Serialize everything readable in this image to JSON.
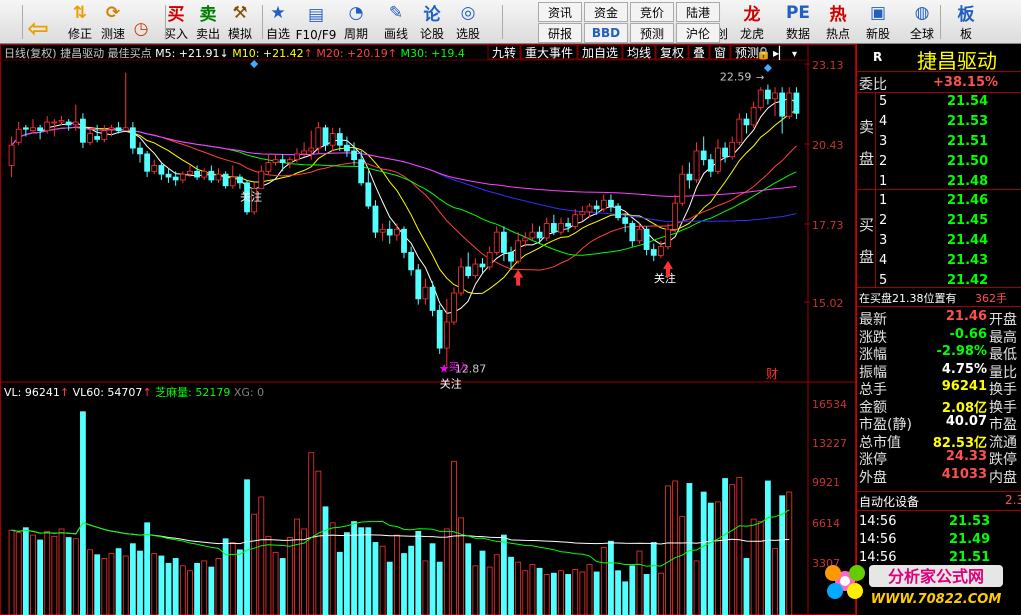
{
  "toolbar": {
    "items": [
      {
        "label": "",
        "icon": "back-arrow-icon"
      },
      {
        "label": "修正",
        "icon": "up-down-arrows-icon"
      },
      {
        "label": "测速",
        "icon": "refresh-icon"
      },
      {
        "label": "",
        "icon": "clock-icon"
      },
      {
        "label": "买入",
        "icon": "buy-icon"
      },
      {
        "label": "卖出",
        "icon": "sell-icon"
      },
      {
        "label": "模拟",
        "icon": "hammer-icon"
      },
      {
        "label": "自选",
        "icon": "star-icon"
      },
      {
        "label": "F10/F9",
        "icon": "f10-icon"
      },
      {
        "label": "周期",
        "icon": "period-icon"
      },
      {
        "label": "画线",
        "icon": "pen-icon"
      },
      {
        "label": "论股",
        "icon": "discuss-icon"
      },
      {
        "label": "选股",
        "icon": "select-stock-icon"
      },
      {
        "label": "科创",
        "icon": "sci-tech-icon"
      },
      {
        "label": "龙虎",
        "icon": "dragon-tiger-icon"
      },
      {
        "label": "数据",
        "icon": "pe-data-icon"
      },
      {
        "label": "热点",
        "icon": "hot-icon"
      },
      {
        "label": "新股",
        "icon": "new-stock-icon"
      },
      {
        "label": "全球",
        "icon": "globe-icon"
      },
      {
        "label": "板",
        "icon": "board-icon"
      }
    ],
    "grid": [
      [
        "资讯",
        "资金",
        "竞价",
        "陆港"
      ],
      [
        "研报",
        "BBD",
        "预测",
        "沪伦"
      ]
    ]
  },
  "chart": {
    "period": "日线(复权)",
    "stock": "捷昌驱动",
    "indicator": "最佳买点",
    "ma5": "M5: +21.91",
    "ma5_arrow": "↓",
    "ma10": "M10: +21.42",
    "ma10_arrow": "↑",
    "ma20": "M20: +20.19",
    "ma20_arrow": "↑",
    "ma30": "M30: +19.4",
    "top_buttons": [
      "九转",
      "重大事件",
      "加自选",
      "均线",
      "复权",
      "叠",
      "窗",
      "预测"
    ],
    "price_axis": [
      "23.13",
      "20.43",
      "17.73",
      "15.02"
    ],
    "vol_axis": [
      "16534",
      "13227",
      "9921",
      "6614",
      "3307"
    ],
    "vol_info": {
      "vl": "VL: 96241",
      "vl_arrow": "↑",
      "vl60": "VL60: 54707",
      "vl60_arrow": "↑",
      "zm": "芝麻量: 52179",
      "xg": "XG: 0"
    },
    "annotations": {
      "high": "22.59",
      "low": "12.87",
      "watch": "关注",
      "buy": "买入",
      "cai": "财"
    }
  },
  "colors": {
    "up": "#ff3232",
    "down": "#54ffff",
    "ma5": "#ffffff",
    "ma10": "#ffff00",
    "ma20": "#ff4040",
    "ma30": "#00ff00",
    "ma60": "#3030ff",
    "ma120": "#ff40ff",
    "bg": "#000000",
    "label_red": "#ff5050"
  },
  "chart_data": {
    "type": "candlestick",
    "candles": [
      [
        19.8,
        20.5,
        20.8,
        19.4
      ],
      [
        20.6,
        21.05,
        21.3,
        20.5
      ],
      [
        21.1,
        21.05,
        21.2,
        20.8
      ],
      [
        21,
        21.1,
        21.4,
        20.9
      ],
      [
        21.1,
        21.0,
        21.2,
        20.7
      ],
      [
        21,
        21.3,
        21.5,
        20.9
      ],
      [
        21.3,
        21.3,
        21.4,
        20.8
      ],
      [
        21.3,
        21.35,
        21.5,
        21.2
      ],
      [
        21.3,
        21.2,
        21.4,
        21.0
      ],
      [
        21.2,
        21.3,
        21.9,
        21.0
      ],
      [
        21.4,
        20.6,
        21.6,
        20.4
      ],
      [
        20.6,
        20.9,
        21.1,
        20.5
      ],
      [
        20.8,
        20.7,
        21.2,
        20.6
      ],
      [
        20.7,
        21.0,
        21.2,
        20.6
      ],
      [
        21.05,
        21.1,
        21.2,
        20.8
      ],
      [
        21.1,
        21.0,
        21.3,
        20.9
      ],
      [
        21.0,
        21.1,
        23.0,
        21.0
      ],
      [
        21.1,
        20.4,
        21.3,
        20.2
      ],
      [
        20.4,
        20.2,
        20.6,
        19.9
      ],
      [
        20.2,
        19.6,
        20.3,
        19.4
      ],
      [
        19.6,
        19.8,
        20.0,
        19.5
      ],
      [
        19.8,
        19.5,
        19.9,
        19.3
      ],
      [
        19.5,
        19.4,
        19.7,
        19.2
      ],
      [
        19.4,
        19.3,
        19.6,
        19.1
      ],
      [
        19.3,
        19.5,
        19.6,
        19.2
      ],
      [
        19.5,
        19.6,
        19.8,
        19.4
      ],
      [
        19.6,
        19.4,
        19.8,
        19.3
      ],
      [
        19.4,
        19.6,
        19.7,
        19.3
      ],
      [
        19.6,
        19.3,
        19.8,
        19.2
      ],
      [
        19.3,
        19.5,
        19.7,
        19.2
      ],
      [
        19.5,
        19.1,
        19.6,
        19.0
      ],
      [
        19.1,
        19.4,
        19.8,
        19.0
      ],
      [
        19.4,
        19.2,
        19.5,
        19.0
      ],
      [
        19.2,
        18.2,
        19.3,
        18.1
      ],
      [
        18.2,
        19.0,
        19.2,
        18.1
      ],
      [
        19.0,
        19.6,
        19.8,
        19.0
      ],
      [
        19.6,
        19.9,
        20.2,
        19.5
      ],
      [
        19.9,
        20.0,
        20.2,
        19.8
      ],
      [
        20.0,
        19.9,
        20.2,
        19.6
      ],
      [
        19.9,
        20.0,
        20.1,
        19.7
      ],
      [
        20.0,
        20.2,
        20.4,
        19.9
      ],
      [
        20.2,
        20.3,
        20.6,
        20.1
      ],
      [
        20.3,
        20.4,
        21.0,
        20.0
      ],
      [
        20.4,
        21.1,
        21.3,
        20.2
      ],
      [
        21.1,
        20.5,
        21.2,
        20.3
      ],
      [
        20.5,
        20.9,
        21.1,
        20.3
      ],
      [
        20.9,
        20.5,
        21.1,
        20.3
      ],
      [
        20.5,
        20.3,
        20.8,
        20.1
      ],
      [
        20.3,
        20.0,
        20.6,
        19.8
      ],
      [
        20.0,
        19.2,
        20.3,
        19.1
      ],
      [
        19.2,
        18.4,
        19.6,
        18.3
      ],
      [
        18.4,
        17.5,
        18.6,
        17.3
      ],
      [
        17.5,
        17.6,
        17.8,
        17.2
      ],
      [
        17.6,
        17.4,
        17.9,
        17.1
      ],
      [
        17.4,
        17.6,
        17.8,
        17.2
      ],
      [
        17.6,
        16.8,
        17.7,
        16.6
      ],
      [
        16.8,
        16.2,
        17.0,
        16.0
      ],
      [
        16.2,
        15.2,
        16.4,
        15.0
      ],
      [
        15.2,
        15.6,
        15.9,
        15.0
      ],
      [
        15.6,
        14.8,
        15.8,
        14.6
      ],
      [
        14.8,
        13.5,
        15.0,
        13.3
      ],
      [
        13.5,
        14.4,
        15.2,
        12.87
      ],
      [
        14.4,
        15.4,
        15.6,
        14.3
      ],
      [
        15.4,
        16.3,
        16.6,
        15.3
      ],
      [
        16.3,
        16.0,
        16.8,
        15.9
      ],
      [
        16.0,
        16.4,
        16.6,
        15.9
      ],
      [
        16.4,
        16.3,
        16.6,
        16.1
      ],
      [
        16.3,
        16.8,
        17.0,
        16.2
      ],
      [
        16.8,
        17.5,
        17.7,
        16.7
      ],
      [
        17.5,
        16.8,
        17.7,
        16.5
      ],
      [
        16.8,
        16.5,
        17.0,
        16.2
      ],
      [
        16.5,
        17.2,
        17.5,
        16.4
      ],
      [
        17.2,
        17.3,
        17.5,
        17.0
      ],
      [
        17.3,
        17.5,
        17.8,
        17.2
      ],
      [
        17.5,
        17.3,
        17.7,
        17.1
      ],
      [
        17.3,
        17.8,
        18.0,
        17.2
      ],
      [
        17.8,
        17.5,
        18.1,
        17.4
      ],
      [
        17.5,
        17.8,
        18.0,
        17.4
      ],
      [
        17.8,
        17.7,
        18.0,
        17.5
      ],
      [
        17.7,
        18.1,
        18.3,
        17.6
      ],
      [
        18.1,
        18.2,
        18.4,
        17.9
      ],
      [
        18.2,
        18.4,
        18.5,
        18.0
      ],
      [
        18.4,
        18.3,
        18.6,
        18.1
      ],
      [
        18.3,
        18.6,
        18.8,
        18.2
      ],
      [
        18.6,
        18.4,
        18.8,
        18.2
      ],
      [
        18.4,
        18.0,
        18.5,
        17.9
      ],
      [
        18.0,
        17.8,
        18.1,
        17.5
      ],
      [
        17.8,
        17.2,
        17.9,
        17.0
      ],
      [
        17.2,
        17.6,
        17.8,
        17.1
      ],
      [
        17.6,
        16.9,
        17.7,
        16.7
      ],
      [
        16.9,
        16.7,
        17.1,
        16.5
      ],
      [
        16.7,
        17.0,
        17.2,
        16.6
      ],
      [
        17.0,
        17.6,
        17.8,
        16.9
      ],
      [
        17.6,
        18.5,
        18.8,
        17.5
      ],
      [
        18.5,
        19.5,
        19.8,
        18.4
      ],
      [
        19.5,
        19.3,
        19.9,
        19.0
      ],
      [
        19.3,
        20.3,
        20.6,
        19.2
      ],
      [
        20.3,
        20.0,
        20.8,
        19.8
      ],
      [
        20.0,
        19.6,
        20.2,
        19.4
      ],
      [
        19.6,
        20.4,
        20.7,
        19.5
      ],
      [
        20.4,
        20.1,
        20.6,
        19.9
      ],
      [
        20.1,
        20.6,
        20.8,
        20.0
      ],
      [
        20.6,
        21.4,
        21.6,
        20.5
      ],
      [
        21.4,
        21.2,
        21.6,
        20.9
      ],
      [
        21.2,
        21.8,
        22.0,
        21.1
      ],
      [
        21.8,
        22.4,
        22.5,
        21.7
      ],
      [
        22.4,
        22.1,
        22.59,
        21.9
      ],
      [
        22.1,
        22.3,
        22.5,
        21.5
      ],
      [
        22.3,
        21.5,
        22.5,
        20.9
      ],
      [
        21.5,
        22.3,
        22.5,
        21.4
      ],
      [
        22.3,
        21.6,
        22.5,
        21.4
      ]
    ],
    "volume": [
      6900,
      6700,
      7100,
      6500,
      6100,
      6800,
      6400,
      7000,
      6300,
      6200,
      16534,
      5300,
      4900,
      4600,
      5000,
      5400,
      4800,
      5800,
      5200,
      7500,
      5000,
      4800,
      4200,
      4600,
      4000,
      3600,
      4200,
      4400,
      3900,
      4600,
      6200,
      5900,
      5300,
      11000,
      8200,
      9600,
      6400,
      5100,
      4600,
      6300,
      7800,
      7000,
      13200,
      11700,
      8800,
      7500,
      5100,
      6700,
      7600,
      7100,
      7100,
      5900,
      5600,
      4300,
      6500,
      5000,
      5600,
      6800,
      4400,
      5800,
      4300,
      7000,
      12500,
      7900,
      5800,
      4000,
      5200,
      3900,
      4900,
      6500,
      4700,
      4300,
      3600,
      4100,
      3800,
      3300,
      3400,
      3600,
      3300,
      3700,
      3500,
      4100,
      3500,
      5500,
      6000,
      3600,
      2700,
      4000,
      5200,
      3300,
      5900,
      3400,
      10500,
      10900,
      8000,
      10700,
      4400,
      10000,
      9100,
      9200,
      11100,
      10600,
      11200,
      4600,
      7800,
      7600,
      10900,
      5400,
      9700,
      10000
    ],
    "ylim": [
      12.4,
      23.3
    ],
    "vol_ylim": [
      0,
      17000
    ]
  },
  "right_panel": {
    "r": "R",
    "name": "捷昌驱动",
    "weibi": {
      "label": "委比",
      "value": "+38.15%"
    },
    "sell_label": [
      "卖",
      "盘"
    ],
    "buy_label": [
      "买",
      "盘"
    ],
    "sell": [
      {
        "n": "5",
        "p": "21.54"
      },
      {
        "n": "4",
        "p": "21.53"
      },
      {
        "n": "3",
        "p": "21.51"
      },
      {
        "n": "2",
        "p": "21.50"
      },
      {
        "n": "1",
        "p": "21.48"
      }
    ],
    "buy": [
      {
        "n": "1",
        "p": "21.46"
      },
      {
        "n": "2",
        "p": "21.45"
      },
      {
        "n": "3",
        "p": "21.44"
      },
      {
        "n": "4",
        "p": "21.43"
      },
      {
        "n": "5",
        "p": "21.42"
      }
    ],
    "buy_status": "在买盘21.38位置有",
    "buy_hands": "362手",
    "stats": [
      {
        "l": "最新",
        "v": "21.46",
        "r": "开盘",
        "c": "#ff5050"
      },
      {
        "l": "涨跌",
        "v": "-0.66",
        "r": "最高",
        "c": "#00ff00"
      },
      {
        "l": "涨幅",
        "v": "-2.98%",
        "r": "最低",
        "c": "#00ff00"
      },
      {
        "l": "振幅",
        "v": "4.75%",
        "r": "量比",
        "c": "#ffffff"
      },
      {
        "l": "总手",
        "v": "96241",
        "r": "换手",
        "c": "#ffff00"
      },
      {
        "l": "金额",
        "v": "2.08亿",
        "r": "换手",
        "c": "#ffff00"
      },
      {
        "l": "市盈(静)",
        "v": "40.07",
        "r": "市盈",
        "c": "#ffffff"
      },
      {
        "l": "总市值",
        "v": "82.53亿",
        "r": "流通",
        "c": "#ffff00"
      },
      {
        "l": "涨停",
        "v": "24.33",
        "r": "跌停",
        "c": "#ff5050"
      },
      {
        "l": "外盘",
        "v": "41033",
        "r": "内盘",
        "c": "#ff5050"
      }
    ],
    "sector": "自动化设备",
    "sector_val": "2.3",
    "ticks": [
      {
        "t": "14:56",
        "p": "21.53"
      },
      {
        "t": "14:56",
        "p": "21.49"
      },
      {
        "t": "14:56",
        "p": "21.51"
      }
    ]
  },
  "watermark": {
    "title": "分析家公式网",
    "url": "WWW.70822.COM"
  }
}
